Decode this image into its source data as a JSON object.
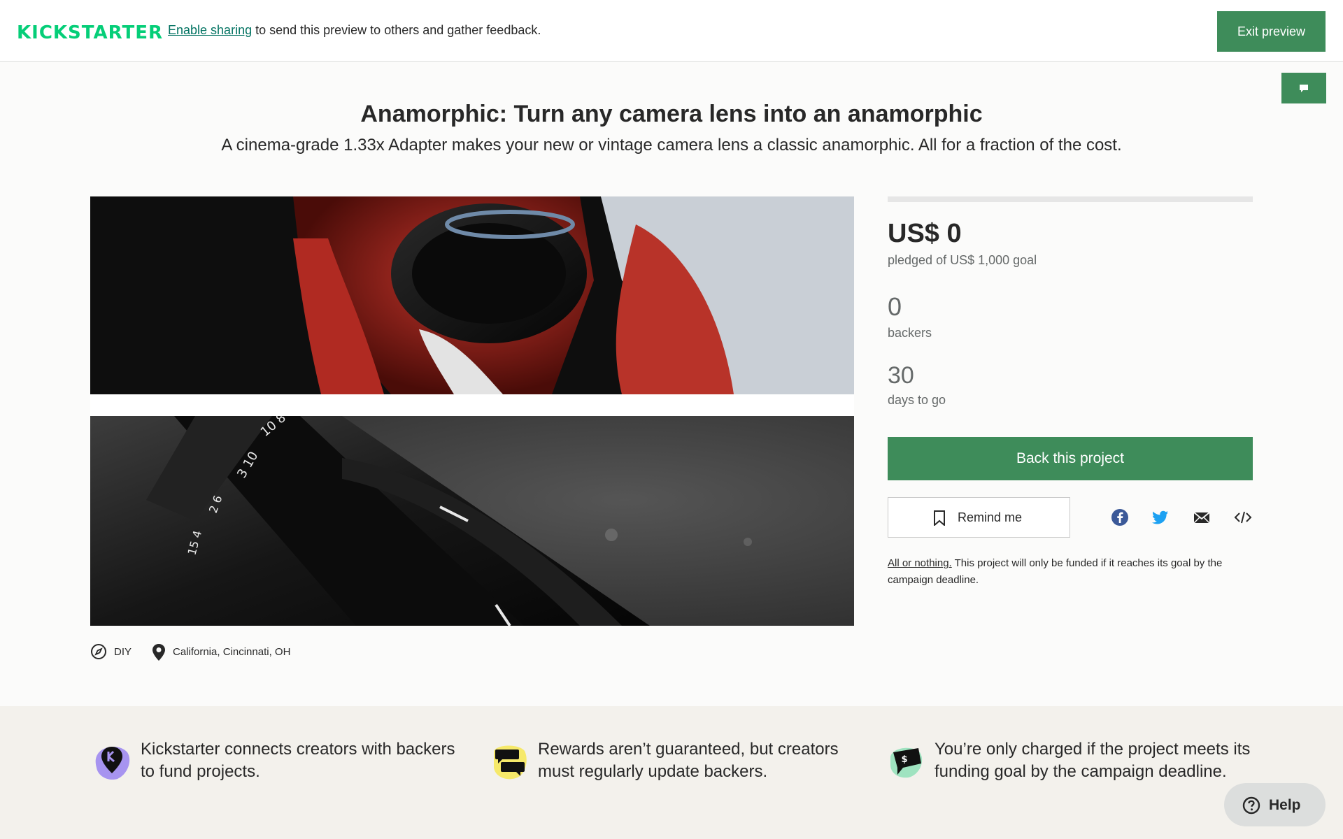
{
  "header": {
    "logo_text": "KICKSTARTER",
    "notice_link": "Enable sharing",
    "notice_text": " to send this preview to others and gather feedback.",
    "exit_label": "Exit preview"
  },
  "project": {
    "title": "Anamorphic: Turn any camera lens into an anamorphic",
    "blurb": "A cinema-grade 1.33x Adapter makes your new or vintage camera lens a classic anamorphic. All for a fraction of the cost.",
    "category": "DIY",
    "location": "California, Cincinnati, OH"
  },
  "stats": {
    "funded_fraction": 0,
    "pledged": "US$ 0",
    "pledged_label": "pledged of US$ 1,000 goal",
    "backers": "0",
    "backers_label": "backers",
    "days": "30",
    "days_label": "days to go"
  },
  "actions": {
    "back_label": "Back this project",
    "remind_label": "Remind me"
  },
  "share_icons": [
    "facebook-icon",
    "twitter-icon",
    "email-icon",
    "embed-icon"
  ],
  "all_or_nothing": {
    "link": "All or nothing.",
    "text": " This project will only be funded if it reaches its goal by the campaign deadline."
  },
  "facts": [
    {
      "text": "Kickstarter connects creators with backers to fund projects."
    },
    {
      "text": "Rewards aren’t guaranteed, but creators must regularly update backers."
    },
    {
      "text": "You’re only charged if the project meets its funding goal by the campaign deadline."
    }
  ],
  "help": {
    "label": "Help"
  },
  "colors": {
    "brand_green": "#05ce78",
    "button_green": "#3e8c5a",
    "link_teal": "#037362",
    "footer_bg": "#f3f1ec"
  }
}
